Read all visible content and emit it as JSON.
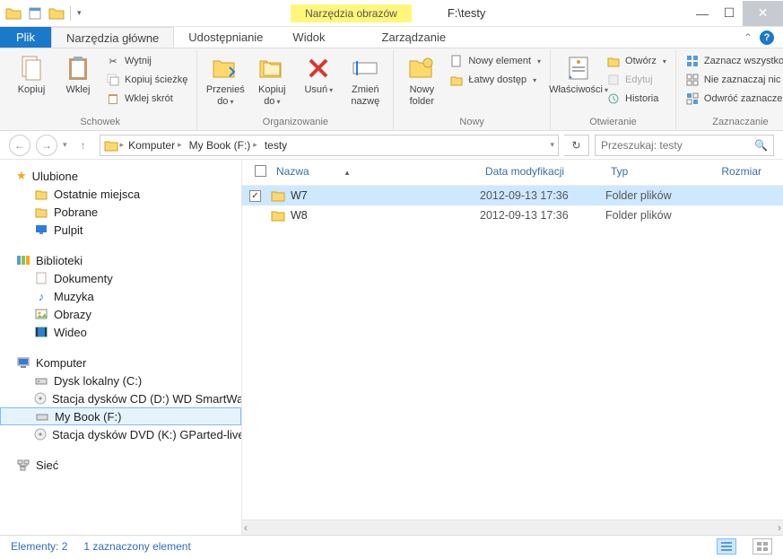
{
  "window": {
    "title": "F:\\testy",
    "context_tab": "Narzędzia obrazów"
  },
  "tabs": {
    "file": "Plik",
    "home": "Narzędzia główne",
    "share": "Udostępnianie",
    "view": "Widok",
    "manage": "Zarządzanie"
  },
  "ribbon": {
    "clipboard": {
      "label": "Schowek",
      "copy": "Kopiuj",
      "paste": "Wklej",
      "cut": "Wytnij",
      "copy_path": "Kopiuj ścieżkę",
      "paste_shortcut": "Wklej skrót"
    },
    "organize": {
      "label": "Organizowanie",
      "move_to": "Przenieś do",
      "copy_to": "Kopiuj do",
      "delete": "Usuń",
      "rename": "Zmień nazwę"
    },
    "new": {
      "label": "Nowy",
      "new_folder": "Nowy folder",
      "new_item": "Nowy element",
      "easy_access": "Łatwy dostęp"
    },
    "open": {
      "label": "Otwieranie",
      "properties": "Właściwości",
      "open": "Otwórz",
      "edit": "Edytuj",
      "history": "Historia"
    },
    "select": {
      "label": "Zaznaczanie",
      "select_all": "Zaznacz wszystko",
      "select_none": "Nie zaznaczaj nic",
      "invert": "Odwróć zaznaczenie"
    }
  },
  "breadcrumb": {
    "items": [
      "Komputer",
      "My Book (F:)",
      "testy"
    ]
  },
  "search": {
    "placeholder": "Przeszukaj: testy"
  },
  "tree": {
    "favorites": {
      "label": "Ulubione",
      "items": [
        "Ostatnie miejsca",
        "Pobrane",
        "Pulpit"
      ]
    },
    "libraries": {
      "label": "Biblioteki",
      "items": [
        "Dokumenty",
        "Muzyka",
        "Obrazy",
        "Wideo"
      ]
    },
    "computer": {
      "label": "Komputer",
      "items": [
        "Dysk lokalny (C:)",
        "Stacja dysków CD (D:) WD SmartWare",
        "My Book (F:)",
        "Stacja dysków DVD (K:) GParted-live"
      ]
    },
    "network": {
      "label": "Sieć"
    }
  },
  "columns": {
    "name": "Nazwa",
    "date": "Data modyfikacji",
    "type": "Typ",
    "size": "Rozmiar"
  },
  "rows": [
    {
      "name": "W7",
      "date": "2012-09-13 17:36",
      "type": "Folder plików",
      "selected": true
    },
    {
      "name": "W8",
      "date": "2012-09-13 17:36",
      "type": "Folder plików",
      "selected": false
    }
  ],
  "status": {
    "count": "Elementy: 2",
    "selected": "1 zaznaczony element"
  }
}
